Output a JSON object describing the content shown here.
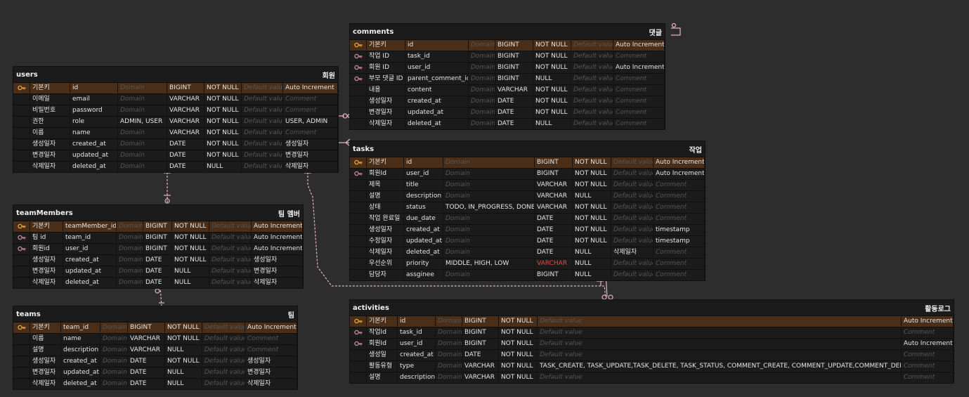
{
  "colors": {
    "background": "#2d2d2d",
    "table": "#1b1b1b",
    "pk_row": "#4a2e18",
    "connector": "#e7b3c5",
    "pk_key": "#e4a83a",
    "fk_key": "#c98b9b"
  },
  "tables": [
    {
      "id": "users",
      "name": "users",
      "logical": "회원",
      "rows": [
        {
          "key": "pk",
          "logical": "기본키",
          "physical": "id",
          "domain": "Domain",
          "type": "BIGINT",
          "nullable": "NOT NULL",
          "default": "Default value",
          "comment": "Auto Increment"
        },
        {
          "key": "",
          "logical": "이메일",
          "physical": "email",
          "domain": "Domain",
          "type": "VARCHAR",
          "nullable": "NOT NULL",
          "default": "Default value",
          "comment": "Comment"
        },
        {
          "key": "",
          "logical": "비밀번호",
          "physical": "password",
          "domain": "Domain",
          "type": "VARCHAR",
          "nullable": "NOT NULL",
          "default": "Default value",
          "comment": "Comment"
        },
        {
          "key": "",
          "logical": "권한",
          "physical": "role",
          "domain": "ADMIN, USER",
          "type": "VARCHAR",
          "nullable": "NOT NULL",
          "default": "Default value",
          "comment": "USER, ADMIN"
        },
        {
          "key": "",
          "logical": "이름",
          "physical": "name",
          "domain": "Domain",
          "type": "VARCHAR",
          "nullable": "NOT NULL",
          "default": "Default value",
          "comment": "Comment"
        },
        {
          "key": "",
          "logical": "생성일자",
          "physical": "created_at",
          "domain": "Domain",
          "type": "DATE",
          "nullable": "NOT NULL",
          "default": "Default value",
          "comment": "생성일자"
        },
        {
          "key": "",
          "logical": "변경일자",
          "physical": "updated_at",
          "domain": "Domain",
          "type": "DATE",
          "nullable": "NOT NULL",
          "default": "Default value",
          "comment": "변경일자"
        },
        {
          "key": "",
          "logical": "삭제일자",
          "physical": "deleted_at",
          "domain": "Domain",
          "type": "DATE",
          "nullable": "NULL",
          "default": "Default value",
          "comment": "삭제일자"
        }
      ]
    },
    {
      "id": "comments",
      "name": "comments",
      "logical": "댓글",
      "rows": [
        {
          "key": "pk",
          "logical": "기본키",
          "physical": "id",
          "domain": "Domain",
          "type": "BIGINT",
          "nullable": "NOT NULL",
          "default": "Default value",
          "comment": "Auto Increment"
        },
        {
          "key": "fk",
          "logical": "작업 ID",
          "physical": "task_id",
          "domain": "Domain",
          "type": "BIGINT",
          "nullable": "NOT NULL",
          "default": "Default value",
          "comment": "Comment"
        },
        {
          "key": "fk",
          "logical": "회원 ID",
          "physical": "user_id",
          "domain": "Domain",
          "type": "BIGINT",
          "nullable": "NOT NULL",
          "default": "Default value",
          "comment": "Auto Increment"
        },
        {
          "key": "fk",
          "logical": "부모 댓글 ID",
          "physical": "parent_comment_id",
          "domain": "Domain",
          "type": "BIGINT",
          "nullable": "NULL",
          "default": "Default value",
          "comment": "Comment"
        },
        {
          "key": "",
          "logical": "내용",
          "physical": "content",
          "domain": "Domain",
          "type": "VARCHAR",
          "nullable": "NOT NULL",
          "default": "Default value",
          "comment": "Comment"
        },
        {
          "key": "",
          "logical": "생성일자",
          "physical": "created_at",
          "domain": "Domain",
          "type": "DATE",
          "nullable": "NOT NULL",
          "default": "Default value",
          "comment": "Comment"
        },
        {
          "key": "",
          "logical": "변경일자",
          "physical": "updated_at",
          "domain": "Domain",
          "type": "DATE",
          "nullable": "NOT NULL",
          "default": "Default value",
          "comment": "Comment"
        },
        {
          "key": "",
          "logical": "삭제일자",
          "physical": "deleted_at",
          "domain": "Domain",
          "type": "DATE",
          "nullable": "NULL",
          "default": "Default value",
          "comment": "Comment"
        }
      ]
    },
    {
      "id": "tasks",
      "name": "tasks",
      "logical": "작업",
      "rows": [
        {
          "key": "pk",
          "logical": "기본키",
          "physical": "id",
          "domain": "Domain",
          "type": "BIGINT",
          "nullable": "NOT NULL",
          "default": "Default value",
          "comment": "Auto Increment"
        },
        {
          "key": "fk",
          "logical": "회원Id",
          "physical": "user_id",
          "domain": "Domain",
          "type": "BIGINT",
          "nullable": "NOT NULL",
          "default": "Default value",
          "comment": "Auto Increment"
        },
        {
          "key": "",
          "logical": "제목",
          "physical": "title",
          "domain": "Domain",
          "type": "VARCHAR",
          "nullable": "NOT NULL",
          "default": "Default value",
          "comment": "Comment"
        },
        {
          "key": "",
          "logical": "설명",
          "physical": "description",
          "domain": "Domain",
          "type": "VARCHAR",
          "nullable": "NULL",
          "default": "Default value",
          "comment": "Comment"
        },
        {
          "key": "",
          "logical": "상태",
          "physical": "status",
          "domain": "TODO, IN_PROGRESS, DONE",
          "type": "VARCHAR",
          "nullable": "NOT NULL",
          "default": "Default value",
          "comment": "Comment"
        },
        {
          "key": "",
          "logical": "작업 완료일",
          "physical": "due_date",
          "domain": "Domain",
          "type": "DATE",
          "nullable": "NOT NULL",
          "default": "Default value",
          "comment": "Comment"
        },
        {
          "key": "",
          "logical": "생성일자",
          "physical": "created_at",
          "domain": "Domain",
          "type": "DATE",
          "nullable": "NOT NULL",
          "default": "Default value",
          "comment": "timestamp"
        },
        {
          "key": "",
          "logical": "수정일자",
          "physical": "updated_at",
          "domain": "Domain",
          "type": "DATE",
          "nullable": "NOT NULL",
          "default": "Default value",
          "comment": "timestamp"
        },
        {
          "key": "",
          "logical": "삭제일자",
          "physical": "deleted_at",
          "domain": "Domain",
          "type": "DATE",
          "nullable": "NULL",
          "default": "삭제일자",
          "comment": "Comment"
        },
        {
          "key": "",
          "logical": "우선순위",
          "physical": "priority",
          "domain": "MIDDLE, HIGH, LOW",
          "type": "VARCHAR",
          "type_red": true,
          "nullable": "NULL",
          "default": "Default value",
          "comment": "Comment"
        },
        {
          "key": "",
          "logical": "담당자",
          "physical": "assginee",
          "domain": "Domain",
          "type": "BIGINT",
          "nullable": "NULL",
          "default": "Default value",
          "comment": "Comment"
        }
      ]
    },
    {
      "id": "teamMembers",
      "name": "teamMembers",
      "logical": "팀 멤버",
      "rows": [
        {
          "key": "pk",
          "logical": "기본키",
          "physical": "teamMember_id",
          "domain": "Domain",
          "type": "BIGINT",
          "nullable": "NOT NULL",
          "default": "Default value",
          "comment": "Auto Increment"
        },
        {
          "key": "fk",
          "logical": "팀 id",
          "physical": "team_id",
          "domain": "Domain",
          "type": "BIGINT",
          "nullable": "NOT NULL",
          "default": "Default value",
          "comment": "Auto Increment"
        },
        {
          "key": "fk",
          "logical": "회원id",
          "physical": "user_id",
          "domain": "Domain",
          "type": "BIGINT",
          "nullable": "NOT NULL",
          "default": "Default value",
          "comment": "Auto Increment"
        },
        {
          "key": "",
          "logical": "생성일자",
          "physical": "created_at",
          "domain": "Domain",
          "type": "DATE",
          "nullable": "NOT NULL",
          "default": "Default value",
          "comment": "생성일자"
        },
        {
          "key": "",
          "logical": "변경일자",
          "physical": "updated_at",
          "domain": "Domain",
          "type": "DATE",
          "nullable": "NULL",
          "default": "Default value",
          "comment": "변경일자"
        },
        {
          "key": "",
          "logical": "삭제일자",
          "physical": "deleted_at",
          "domain": "Domain",
          "type": "DATE",
          "nullable": "NULL",
          "default": "Default value",
          "comment": "삭제일자"
        }
      ]
    },
    {
      "id": "teams",
      "name": "teams",
      "logical": "팀",
      "rows": [
        {
          "key": "pk",
          "logical": "기본키",
          "physical": "team_id",
          "domain": "Domain",
          "type": "BIGINT",
          "nullable": "NOT NULL",
          "default": "Default value",
          "comment": "Auto Increment"
        },
        {
          "key": "",
          "logical": "이름",
          "physical": "name",
          "domain": "Domain",
          "type": "VARCHAR",
          "nullable": "NOT NULL",
          "default": "Default value",
          "comment": "Comment"
        },
        {
          "key": "",
          "logical": "설명",
          "physical": "description",
          "domain": "Domain",
          "type": "VARCHAR",
          "nullable": "NULL",
          "default": "Default value",
          "comment": "Comment"
        },
        {
          "key": "",
          "logical": "생성일자",
          "physical": "created_at",
          "domain": "Domain",
          "type": "DATE",
          "nullable": "NOT NULL",
          "default": "Default value",
          "comment": "생성일자"
        },
        {
          "key": "",
          "logical": "변경일자",
          "physical": "updated_at",
          "domain": "Domain",
          "type": "DATE",
          "nullable": "NULL",
          "default": "Default value",
          "comment": "변경일자"
        },
        {
          "key": "",
          "logical": "삭제일자",
          "physical": "deleted_at",
          "domain": "Domain",
          "type": "DATE",
          "nullable": "NULL",
          "default": "Default value",
          "comment": "삭제일자"
        }
      ]
    },
    {
      "id": "activities",
      "name": "activities",
      "logical": "활동로그",
      "rows": [
        {
          "key": "pk",
          "logical": "기본키",
          "physical": "id",
          "domain": "Domain",
          "type": "BIGINT",
          "nullable": "NOT NULL",
          "default": "Default value",
          "comment": "Auto Increment"
        },
        {
          "key": "fk",
          "logical": "작업Id",
          "physical": "task_id",
          "domain": "Domain",
          "type": "BIGINT",
          "nullable": "NOT NULL",
          "default": "Default value",
          "comment": "Comment"
        },
        {
          "key": "fk",
          "logical": "회원Id",
          "physical": "user_id",
          "domain": "Domain",
          "type": "BIGINT",
          "nullable": "NOT NULL",
          "default": "Default value",
          "comment": "Auto Increment"
        },
        {
          "key": "",
          "logical": "생성일",
          "physical": "created_at",
          "domain": "Domain",
          "type": "DATE",
          "nullable": "NOT NULL",
          "default": "Default value",
          "comment": "Comment"
        },
        {
          "key": "",
          "logical": "활동유형",
          "physical": "type",
          "domain": "Domain",
          "type": "VARCHAR",
          "nullable": "NOT NULL",
          "default": "TASK_CREATE, TASK_UPDATE,TASK_DELETE, TASK_STATUS, COMMENT_CREATE, COMMENT_UPDATE,COMMENT_DELETE",
          "comment": "Comment"
        },
        {
          "key": "",
          "logical": "설명",
          "physical": "description",
          "domain": "Domain",
          "type": "VARCHAR",
          "nullable": "NOT NULL",
          "default": "Default value",
          "comment": "Comment"
        }
      ]
    }
  ]
}
